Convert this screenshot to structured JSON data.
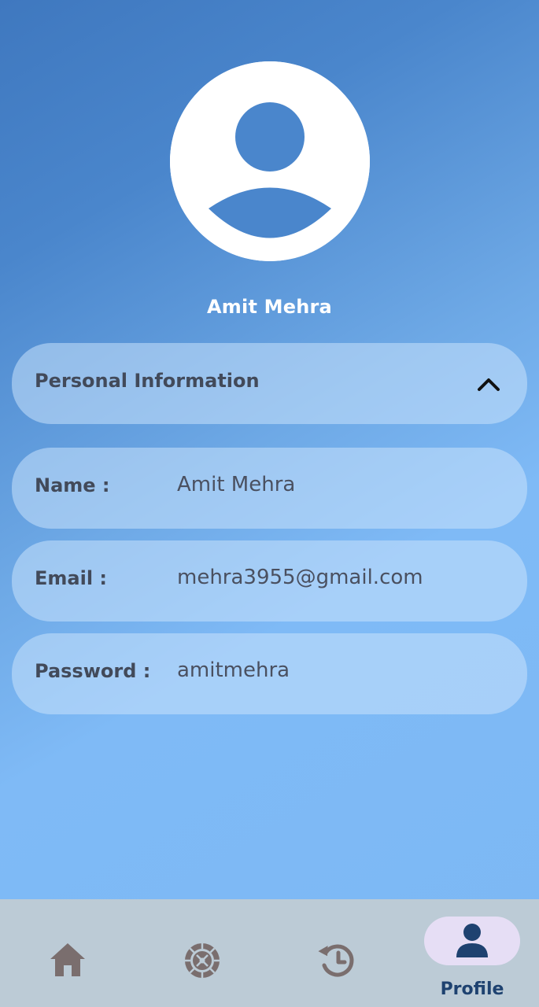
{
  "profile": {
    "name": "Amit Mehra"
  },
  "section": {
    "title": "Personal Information",
    "icon": "chevron-up-icon"
  },
  "fields": [
    {
      "label": "Name :",
      "value": "Amit Mehra"
    },
    {
      "label": "Email :",
      "value": "mehra3955@gmail.com"
    },
    {
      "label": "Password :",
      "value": "amitmehra"
    }
  ],
  "nav": {
    "items": [
      {
        "icon": "home-icon",
        "label": ""
      },
      {
        "icon": "roulette-wheel-icon",
        "label": ""
      },
      {
        "icon": "history-icon",
        "label": ""
      },
      {
        "icon": "profile-icon",
        "label": "Profile",
        "active": true
      }
    ]
  },
  "colors": {
    "accent": "#1e4270",
    "nav_background": "#bccbd6",
    "active_pill": "#e6def5",
    "inactive_icon": "#7a6e6e"
  }
}
